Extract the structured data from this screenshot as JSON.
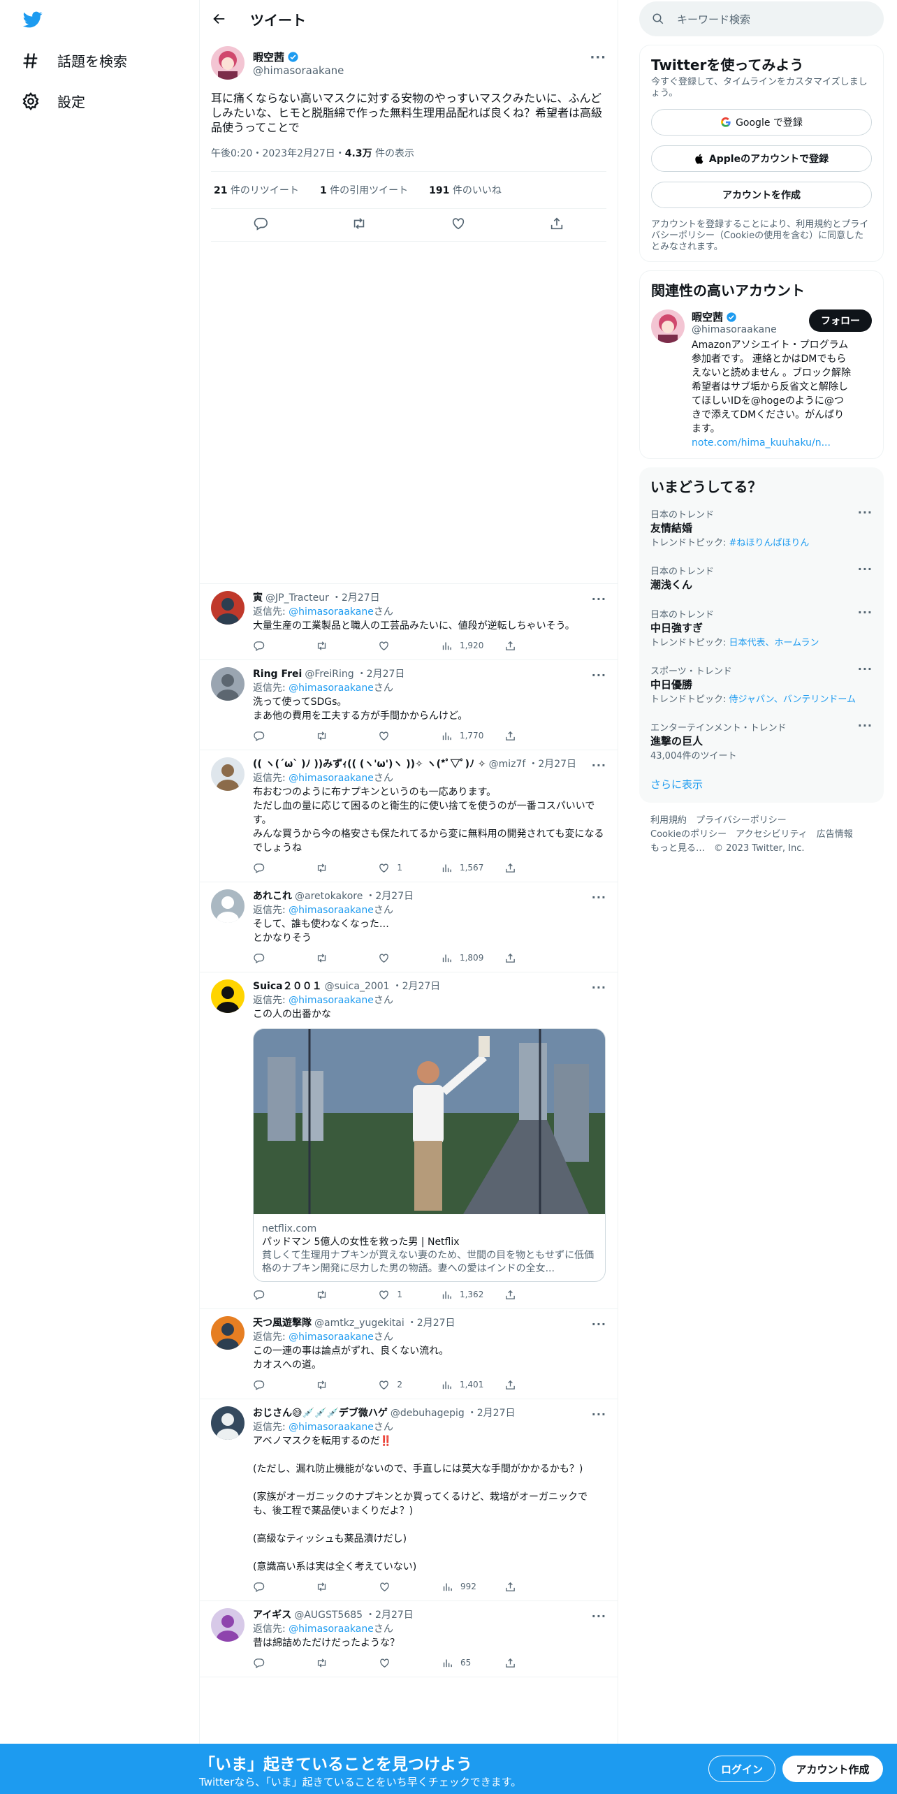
{
  "nav": {
    "explore": "話題を検索",
    "settings": "設定"
  },
  "header": {
    "title": "ツイート"
  },
  "main": {
    "name": "暇空茜",
    "handle": "@himasoraakane",
    "text": "耳に痛くならない高いマスクに対する安物のやっすいマスクみたいに、ふんどしみたいな、ヒモと脱脂綿で作った無料生理用品配れば良くね？希望者は高級品使うってことで",
    "time": "午後0:20・2023年2月27日・",
    "views": "4.3万",
    "views_suffix": " 件の表示",
    "retweets": "21",
    "retweets_label": " 件のリツイート",
    "quotes": "1",
    "quotes_label": " 件の引用ツイート",
    "likes": "191",
    "likes_label": " 件のいいね"
  },
  "replies": [
    {
      "name": "寅",
      "handle": "@JP_Tracteur",
      "date": "・2月27日",
      "to_pre": "返信先: ",
      "to": "@himasoraakane",
      "to_suf": "さん",
      "text": "大量生産の工業製品と職人の工芸品みたいに、値段が逆転しちゃいそう。",
      "likes": "",
      "views": "1,920"
    },
    {
      "name": "Ring Frei",
      "handle": "@FreiRing",
      "date": "・2月27日",
      "to_pre": "返信先: ",
      "to": "@himasoraakane",
      "to_suf": "さん",
      "text": "洗って使ってSDGs。\nまあ他の費用を工夫する方が手間かからんけど。",
      "likes": "",
      "views": "1,770"
    },
    {
      "name": "(( ヽ(´ω` )ﾉ ))みずｨ(( (ヽ'ω')ヽ ))✧ ヽ(*ﾟ▽ﾟ)ﾉ ✧",
      "handle": "@miz7f",
      "date": "・2月27日",
      "to_pre": "返信先: ",
      "to": "@himasoraakane",
      "to_suf": "さん",
      "text": "布おむつのように布ナプキンというのも一応あります。\nただし血の量に応じて困るのと衛生的に使い捨てを使うのが一番コスパいいです。\nみんな買うから今の格安さも保たれてるから変に無料用の開発されても変になるでしょうね",
      "likes": "1",
      "views": "1,567"
    },
    {
      "name": "あれこれ",
      "handle": "@aretokakore",
      "date": "・2月27日",
      "to_pre": "返信先: ",
      "to": "@himasoraakane",
      "to_suf": "さん",
      "text": "そして、誰も使わなくなった…\nとかなりそう",
      "likes": "",
      "views": "1,809"
    },
    {
      "name": "Suica２００１",
      "handle": "@suica_2001",
      "date": "・2月27日",
      "to_pre": "返信先: ",
      "to": "@himasoraakane",
      "to_suf": "さん",
      "text": "この人の出番かな",
      "likes": "1",
      "views": "1,362",
      "card": {
        "domain": "netflix.com",
        "title": "パッドマン 5億人の女性を救った男 | Netflix",
        "desc": "貧しくて生理用ナプキンが買えない妻のため、世間の目を物ともせずに低価格のナプキン開発に尽力した男の物語。妻への愛はインドの全女..."
      }
    },
    {
      "name": "天つ風遊撃隊",
      "handle": "@amtkz_yugekitai",
      "date": "・2月27日",
      "to_pre": "返信先: ",
      "to": "@himasoraakane",
      "to_suf": "さん",
      "text": "この一連の事は論点がずれ、良くない流れ。\nカオスへの道。",
      "likes": "2",
      "views": "1,401"
    },
    {
      "name": "おじさん😅💉💉💉デブ微ハゲ",
      "handle": "@debuhagepig",
      "date": "・2月27日",
      "to_pre": "返信先: ",
      "to": "@himasoraakane",
      "to_suf": "さん",
      "text": "アベノマスクを転用するのだ‼️\n\n(ただし、漏れ防止機能がないので、手直しには莫大な手間がかかるかも？)\n\n(家族がオーガニックのナプキンとか買ってくるけど、栽培がオーガニックでも、後工程で薬品使いまくりだよ？)\n\n(高級なティッシュも薬品漬けだし)\n\n(意識高い系は実は全く考えていない)",
      "likes": "",
      "views": "992"
    },
    {
      "name": "アイギス",
      "handle": "@AUGST5685",
      "date": "・2月27日",
      "to_pre": "返信先: ",
      "to": "@himasoraakane",
      "to_suf": "さん",
      "text": "昔は綿詰めただけだったような？",
      "likes": "",
      "views": "65"
    }
  ],
  "right": {
    "search_placeholder": "キーワード検索",
    "signup_title": "Twitterを使ってみよう",
    "signup_sub": "今すぐ登録して、タイムラインをカスタマイズしましょう。",
    "google": "Google で登録",
    "apple": "Appleのアカウントで登録",
    "create": "アカウントを作成",
    "terms": "アカウントを登録することにより、利用規約とプライバシーポリシー（Cookieの使用を含む）に同意したとみなされます。",
    "related_title": "関連性の高いアカウント",
    "rel_name": "暇空茜",
    "rel_handle": "@himasoraakane",
    "follow": "フォロー",
    "rel_bio": "Amazonアソシエイト・プログラム参加者です。 連絡とかはDMでもらえないと読めません 。ブロック解除希望者はサブ垢から反省文と解除してほしいIDを@hogeのように@つきで添えてDMください。がんばります。",
    "rel_link": "note.com/hima_kuuhaku/n...",
    "trends_title": "いまどうしてる？",
    "trends": [
      {
        "cat": "日本のトレンド",
        "name": "友情結婚",
        "sub": "トレンドトピック: ",
        "subv": "#ねほりんぱほりん"
      },
      {
        "cat": "日本のトレンド",
        "name": "潮浅くん",
        "sub": "",
        "subv": ""
      },
      {
        "cat": "日本のトレンド",
        "name": "中日強すぎ",
        "sub": "トレンドトピック: ",
        "subv": "日本代表、ホームラン"
      },
      {
        "cat": "スポーツ・トレンド",
        "name": "中日優勝",
        "sub": "トレンドトピック: ",
        "subv": "侍ジャパン、バンテリンドーム"
      },
      {
        "cat": "エンターテインメント・トレンド",
        "name": "進撃の巨人",
        "sub": "43,004件のツイート",
        "subv": ""
      }
    ],
    "show_more": "さらに表示",
    "footer1": "利用規約　プライバシーポリシー",
    "footer2": "Cookieのポリシー　アクセシビリティ　広告情報",
    "footer3": "もっと見る…　© 2023 Twitter, Inc."
  },
  "bottom": {
    "title": "「いま」起きていることを見つけよう",
    "sub": "Twitterなら、「いま」起きていることをいち早くチェックできます。",
    "login": "ログイン",
    "signup": "アカウント作成"
  },
  "colors": {
    "accent": "#1d9bf0",
    "text": "#0f1419",
    "muted": "#536471"
  }
}
